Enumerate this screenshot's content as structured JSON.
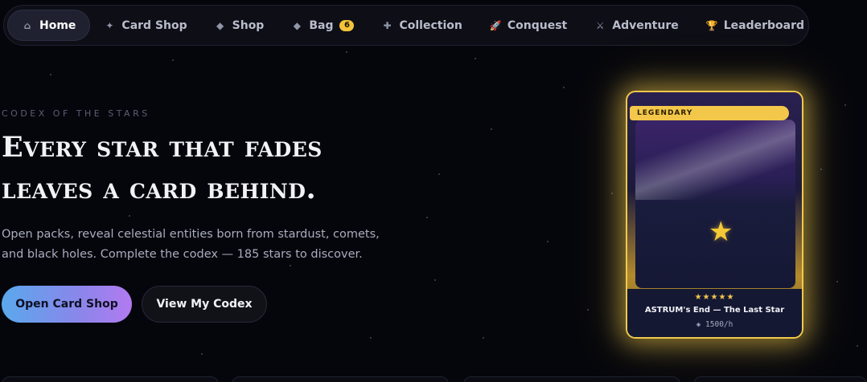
{
  "nav": {
    "items": [
      {
        "label": "Home",
        "icon": "home-icon",
        "glyph": "⌂",
        "active": true
      },
      {
        "label": "Card Shop",
        "icon": "sparkle-icon",
        "glyph": "✦"
      },
      {
        "label": "Shop",
        "icon": "diamond-icon",
        "glyph": "◆"
      },
      {
        "label": "Bag",
        "icon": "diamond-icon",
        "glyph": "◆",
        "badge": "6"
      },
      {
        "label": "Collection",
        "icon": "plus-circle-icon",
        "glyph": "✚"
      },
      {
        "label": "Conquest",
        "icon": "rocket-icon",
        "glyph": "🚀"
      },
      {
        "label": "Adventure",
        "icon": "crossed-swords-icon",
        "glyph": "⚔"
      },
      {
        "label": "Leaderboard",
        "icon": "trophy-icon",
        "glyph": "🏆"
      }
    ]
  },
  "hero": {
    "eyebrow": "Codex of the Stars",
    "headline_line1": "Every star that fades",
    "headline_line2": "leaves a card behind.",
    "lede_line1": "Open packs, reveal celestial entities born from stardust, comets,",
    "lede_line2": "and black holes. Complete the codex — 185 stars to discover.",
    "primary_button": "Open Card Shop",
    "secondary_button": "View My Codex"
  },
  "card": {
    "rarity": "LEGENDARY",
    "rating": "★★★★★",
    "name": "ASTRUM's End — The Last Star",
    "rate": "◈ 1500/h",
    "accent_color": "#f1c94a"
  }
}
